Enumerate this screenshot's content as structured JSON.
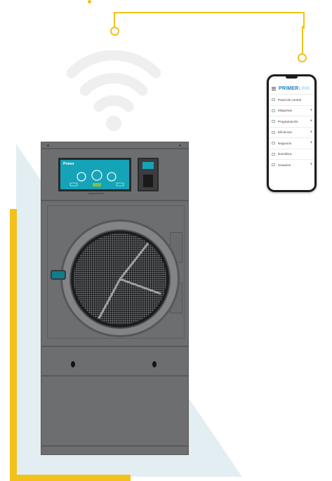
{
  "colors": {
    "accent_yellow": "#f2c21a",
    "triangle_light_blue": "#e3eef3",
    "wifi_grey": "#efefef",
    "machine_grey": "#6d6e70",
    "screen_teal": "#15a3b8",
    "brand_blue": "#1b7fb8"
  },
  "machine": {
    "screen_logo": "Primer",
    "screen_footer": "www.primer.es"
  },
  "phone": {
    "brand_strong": "PRIMER",
    "brand_light": "LINK",
    "menu": [
      {
        "label": "Panel de control",
        "icon": "dashboard-icon",
        "expandable": false
      },
      {
        "label": "Máquinas",
        "icon": "machine-icon",
        "expandable": true
      },
      {
        "label": "Programación",
        "icon": "monitor-icon",
        "expandable": true
      },
      {
        "label": "Eficiencia",
        "icon": "leaf-icon",
        "expandable": true
      },
      {
        "label": "Negocios",
        "icon": "briefcase-icon",
        "expandable": true
      },
      {
        "label": "Domótica",
        "icon": "plug-icon",
        "expandable": false
      },
      {
        "label": "Usuarios",
        "icon": "users-icon",
        "expandable": true
      }
    ],
    "plus_symbol": "+"
  },
  "icons": {
    "wifi": "wifi-icon",
    "hamburger": "menu-icon"
  }
}
